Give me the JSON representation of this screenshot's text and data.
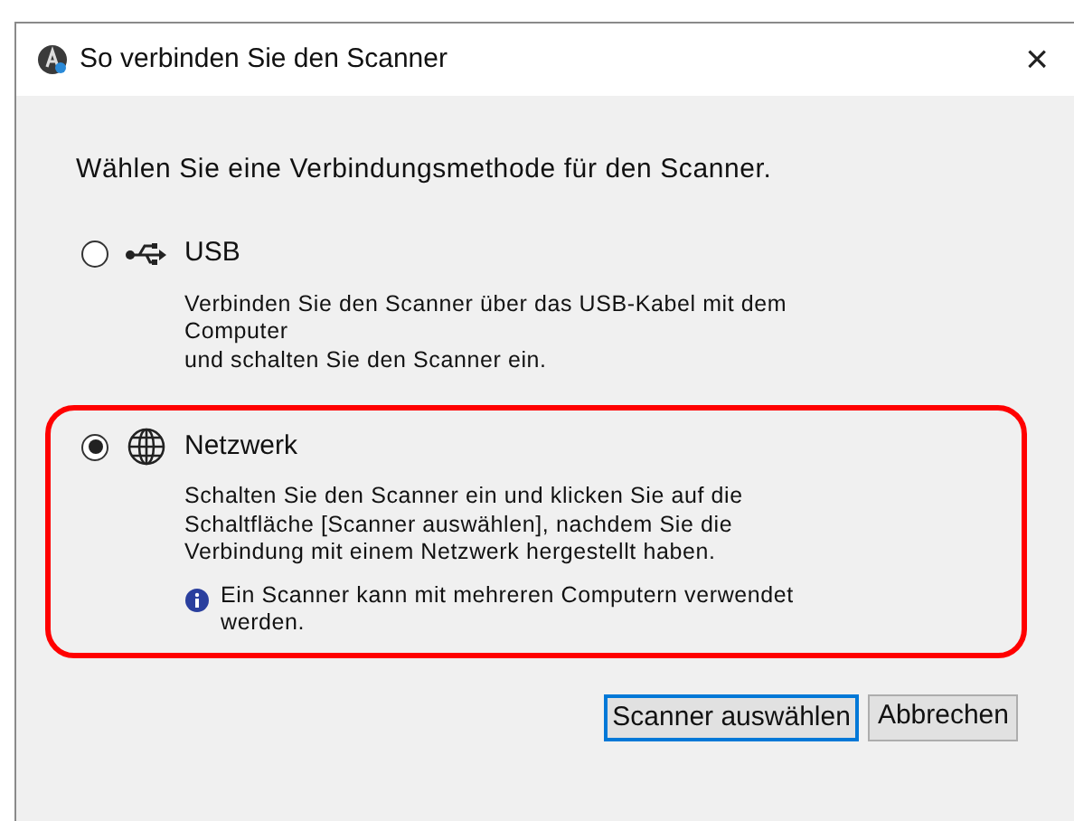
{
  "window": {
    "title": "So verbinden Sie den Scanner",
    "close": "×"
  },
  "instruction": "Wählen Sie eine Verbindungsmethode für den Scanner.",
  "options": [
    {
      "kind": "usb",
      "label": "USB",
      "selected": false,
      "highlighted": false,
      "description": [
        "Verbinden Sie den Scanner über das USB-Kabel mit dem",
        "Computer",
        "und schalten Sie den Scanner ein."
      ]
    },
    {
      "kind": "network",
      "label": "Netzwerk",
      "selected": true,
      "highlighted": true,
      "description": [
        "Schalten Sie den Scanner ein und klicken Sie auf die",
        "Schaltfläche [Scanner auswählen], nachdem Sie die",
        "Verbindung mit einem Netzwerk hergestellt haben."
      ],
      "note": [
        "Ein Scanner kann mit mehreren Computern verwendet",
        "werden."
      ]
    }
  ],
  "buttons": [
    {
      "label": "Scanner auswählen",
      "default": true
    },
    {
      "label": "Abbrechen",
      "default": false
    }
  ]
}
